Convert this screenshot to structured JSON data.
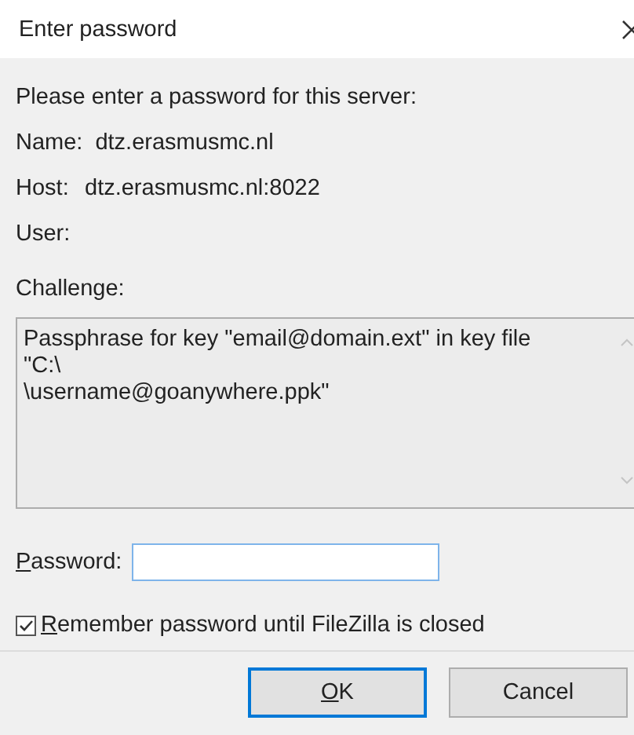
{
  "window": {
    "title": "Enter password"
  },
  "prompt": "Please enter a password for this server:",
  "fields": [
    {
      "label": "Name:",
      "value": "dtz.erasmusmc.nl"
    },
    {
      "label": "Host:",
      "value": "dtz.erasmusmc.nl:8022"
    },
    {
      "label": "User:"
    }
  ],
  "challenge": {
    "label": "Challenge:",
    "text": "Passphrase for key \"email@domain.ext\" in key file\n\"C:\\\n\\username@goanywhere.ppk\""
  },
  "password": {
    "label": "Password:"
  },
  "remember": {
    "label": "Remember password until FileZilla is closed",
    "checked": true
  },
  "buttons": [
    {
      "label": "OK",
      "default": true
    },
    {
      "label": "Cancel",
      "default": false
    }
  ]
}
